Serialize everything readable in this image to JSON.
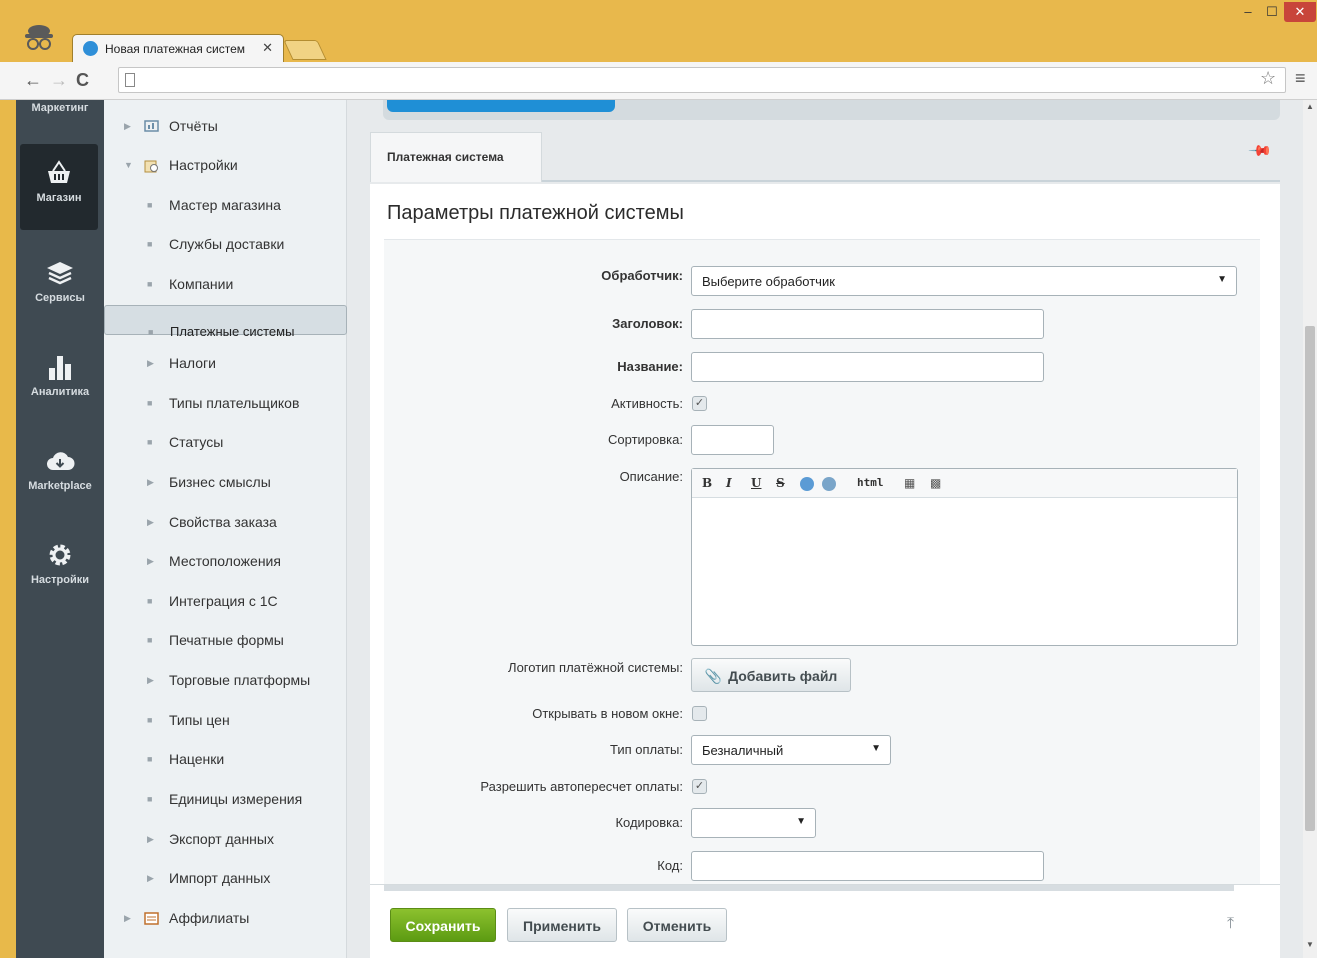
{
  "browser": {
    "tab_title": "Новая платежная систем",
    "tab_close": "✕",
    "win_min": "–",
    "win_max": "☐",
    "win_close": "✕",
    "nav_back": "←",
    "nav_forward": "→",
    "nav_reload": "C",
    "star_icon": "☆",
    "menu_icon": "≡"
  },
  "leftbar": {
    "items": [
      {
        "label": "Маркетинг",
        "icon": ""
      },
      {
        "label": "Магазин",
        "icon": "basket-icon"
      },
      {
        "label": "Сервисы",
        "icon": "layers-icon"
      },
      {
        "label": "Аналитика",
        "icon": "bar-chart-icon"
      },
      {
        "label": "Marketplace",
        "icon": "cloud-download-icon"
      },
      {
        "label": "Настройки",
        "icon": "gear-icon"
      }
    ]
  },
  "menu": {
    "items": [
      {
        "label": "Отчёты",
        "marker": "▶"
      },
      {
        "label": "Настройки",
        "marker": "▼"
      },
      {
        "label": "Мастер магазина",
        "marker": "■"
      },
      {
        "label": "Службы доставки",
        "marker": "■"
      },
      {
        "label": "Компании",
        "marker": "■"
      },
      {
        "label": "Платежные системы",
        "marker": "■"
      },
      {
        "label": "Налоги",
        "marker": "▶"
      },
      {
        "label": "Типы плательщиков",
        "marker": "■"
      },
      {
        "label": "Статусы",
        "marker": "■"
      },
      {
        "label": "Бизнес смыслы",
        "marker": "▶"
      },
      {
        "label": "Свойства заказа",
        "marker": "▶"
      },
      {
        "label": "Местоположения",
        "marker": "▶"
      },
      {
        "label": "Интеграция с 1С",
        "marker": "■"
      },
      {
        "label": "Печатные формы",
        "marker": "■"
      },
      {
        "label": "Торговые платформы",
        "marker": "▶"
      },
      {
        "label": "Типы цен",
        "marker": "■"
      },
      {
        "label": "Наценки",
        "marker": "■"
      },
      {
        "label": "Единицы измерения",
        "marker": "■"
      },
      {
        "label": "Экспорт данных",
        "marker": "▶"
      },
      {
        "label": "Импорт данных",
        "marker": "▶"
      },
      {
        "label": "Аффилиаты",
        "marker": "▶"
      }
    ],
    "selected_index": 5
  },
  "content": {
    "tab_label": "Платежная система",
    "heading": "Параметры платежной системы",
    "form": {
      "handler_label": "Обработчик:",
      "handler_value": "Выберите обработчик",
      "title_label": "Заголовок:",
      "title_value": "",
      "name_label": "Название:",
      "name_value": "",
      "active_label": "Активность:",
      "active_checked": true,
      "sort_label": "Сортировка:",
      "sort_value": "",
      "description_label": "Описание:",
      "editor_buttons": [
        "B",
        "I",
        "U",
        "S",
        "html"
      ],
      "logo_label": "Логотип платёжной системы:",
      "add_file_label": "Добавить файл",
      "new_window_label": "Открывать в новом окне:",
      "new_window_checked": false,
      "pay_type_label": "Тип оплаты:",
      "pay_type_value": "Безналичный",
      "auto_recalc_label": "Разрешить автопересчет оплаты:",
      "auto_recalc_checked": true,
      "encoding_label": "Кодировка:",
      "encoding_value": "",
      "code_label": "Код:",
      "code_value": ""
    },
    "buttons": {
      "save": "Сохранить",
      "apply": "Применить",
      "cancel": "Отменить"
    }
  },
  "colors": {
    "accent_blue": "#1f8fd6",
    "save_green": "#6aa81c",
    "sidebar_dark": "#3f4a52",
    "titlebar": "#e8b84c"
  }
}
